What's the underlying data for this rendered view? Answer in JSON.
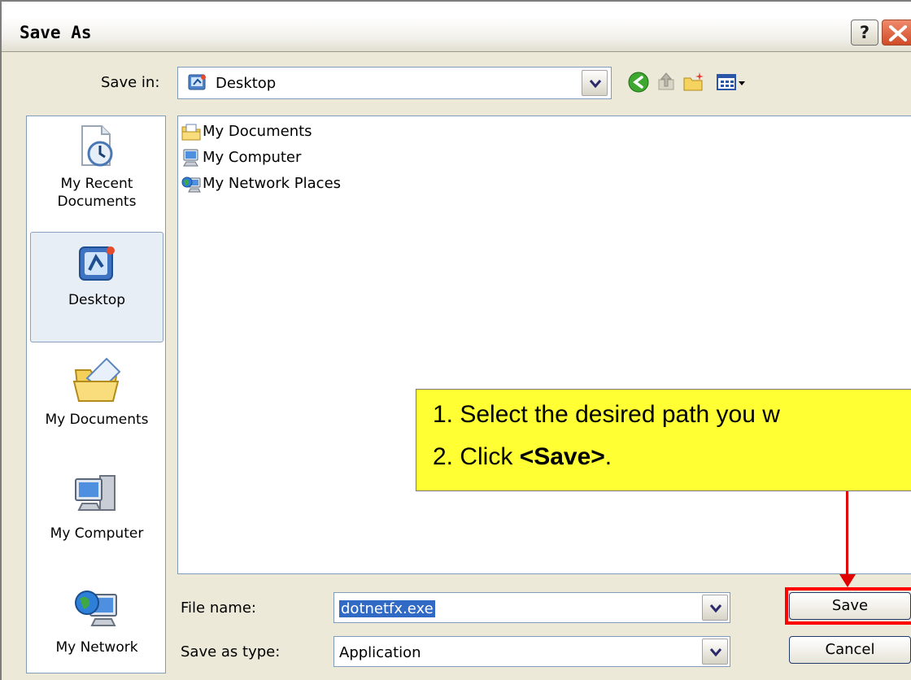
{
  "window": {
    "title": "Save As",
    "help_label": "?"
  },
  "save_in": {
    "label": "Save in:",
    "value": "Desktop"
  },
  "toolbar": {
    "icons": [
      "back-icon",
      "up-folder-icon",
      "new-folder-icon",
      "view-menu-icon"
    ]
  },
  "places": [
    {
      "label_line1": "My Recent",
      "label_line2": "Documents",
      "icon": "recent-documents-icon"
    },
    {
      "label_line1": "Desktop",
      "label_line2": "",
      "icon": "desktop-icon",
      "selected": true
    },
    {
      "label_line1": "My Documents",
      "label_line2": "",
      "icon": "my-documents-icon"
    },
    {
      "label_line1": "My Computer",
      "label_line2": "",
      "icon": "my-computer-icon"
    },
    {
      "label_line1": "My Network",
      "label_line2": "",
      "icon": "my-network-icon"
    }
  ],
  "files": [
    {
      "name": "My Documents",
      "icon": "folder-icon"
    },
    {
      "name": "My Computer",
      "icon": "computer-icon"
    },
    {
      "name": "My Network Places",
      "icon": "network-icon"
    }
  ],
  "file_name": {
    "label": "File name:",
    "value": "dotnetfx.exe"
  },
  "save_as_type": {
    "label": "Save as type:",
    "value": "Application"
  },
  "buttons": {
    "save": "Save",
    "cancel": "Cancel"
  },
  "callout": {
    "line1": "1. Select the desired path you w",
    "line2_prefix": "2. Click ",
    "line2_bold": "<Save>",
    "line2_suffix": "."
  },
  "colors": {
    "callout_bg": "#ffff33",
    "highlight_red": "#ff0000",
    "selection_blue": "#316ac5"
  }
}
